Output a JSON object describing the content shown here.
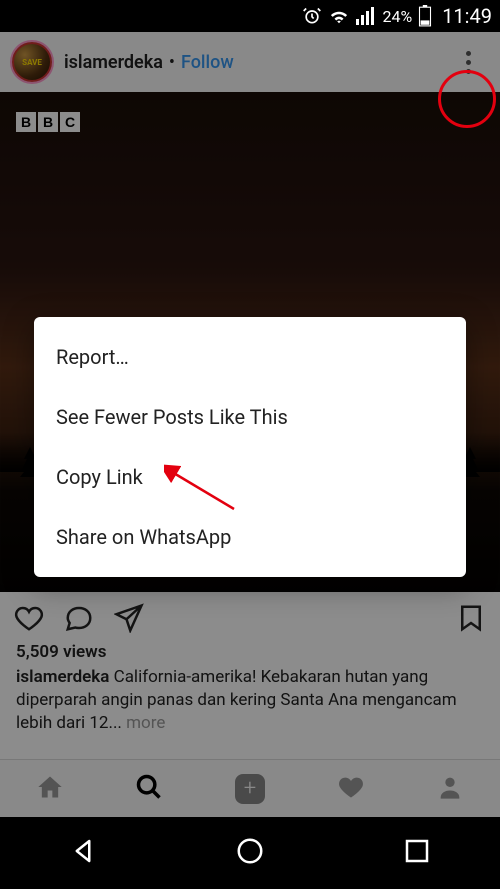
{
  "status": {
    "battery_pct": "24%",
    "time": "11:49"
  },
  "post": {
    "avatar_text": "SAVE",
    "username": "islamerdeka",
    "separator": "•",
    "follow": "Follow",
    "bbc_letters": [
      "B",
      "B",
      "C"
    ],
    "views": "5,509 views",
    "caption_user": "islamerdeka",
    "caption_text": " California-amerika! Kebakaran hutan yang diperparah angin panas dan kering Santa Ana mengancam lebih dari 12",
    "caption_ellipsis": "... ",
    "more": "more"
  },
  "menu": {
    "items": [
      "Report…",
      "See Fewer Posts Like This",
      "Copy Link",
      "Share on WhatsApp"
    ]
  },
  "tabs": {
    "add_glyph": "+"
  }
}
